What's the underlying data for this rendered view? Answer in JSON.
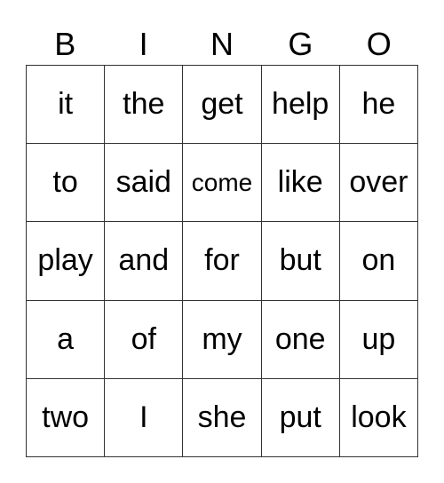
{
  "header": {
    "letters": [
      "B",
      "I",
      "N",
      "G",
      "O"
    ]
  },
  "card": {
    "rows": [
      [
        "it",
        "the",
        "get",
        "help",
        "he"
      ],
      [
        "to",
        "said",
        "come",
        "like",
        "over"
      ],
      [
        "play",
        "and",
        "for",
        "but",
        "on"
      ],
      [
        "a",
        "of",
        "my",
        "one",
        "up"
      ],
      [
        "two",
        "I",
        "she",
        "put",
        "look"
      ]
    ]
  }
}
